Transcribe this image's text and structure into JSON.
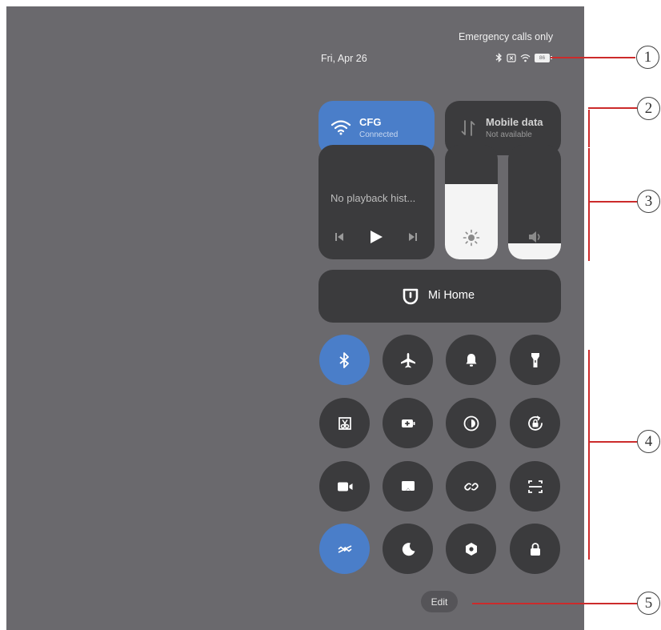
{
  "status_bar": {
    "carrier_text": "Emergency calls only",
    "date": "Fri, Apr 26",
    "battery_level": "86"
  },
  "tiles": {
    "wifi": {
      "title": "CFG",
      "status": "Connected",
      "active": true
    },
    "mobile_data": {
      "title": "Mobile data",
      "status": "Not available",
      "active": false
    }
  },
  "media": {
    "title": "No playback hist..."
  },
  "sliders": {
    "brightness": {
      "level": 0.66
    },
    "volume": {
      "level": 0.14
    }
  },
  "mi_home": {
    "label": "Mi Home"
  },
  "toggles": [
    {
      "icon": "bluetooth-icon",
      "active": true
    },
    {
      "icon": "airplane-icon",
      "active": false
    },
    {
      "icon": "bell-icon",
      "active": false
    },
    {
      "icon": "flashlight-icon",
      "active": false
    },
    {
      "icon": "screenshot-icon",
      "active": false
    },
    {
      "icon": "battery-saver-icon",
      "active": false
    },
    {
      "icon": "dark-mode-icon",
      "active": false
    },
    {
      "icon": "auto-rotate-lock-icon",
      "active": false
    },
    {
      "icon": "screen-recorder-icon",
      "active": false
    },
    {
      "icon": "cast-icon",
      "active": false
    },
    {
      "icon": "link-icon",
      "active": false
    },
    {
      "icon": "scanner-icon",
      "active": false
    },
    {
      "icon": "reading-mode-icon",
      "active": true
    },
    {
      "icon": "do-not-disturb-icon",
      "active": false
    },
    {
      "icon": "settings-nut-icon",
      "active": false
    },
    {
      "icon": "lock-screen-icon",
      "active": false
    }
  ],
  "edit_label": "Edit",
  "callouts": [
    "1",
    "2",
    "3",
    "4",
    "5"
  ],
  "colors": {
    "accent_blue": "#4a7ec9",
    "tile_dark": "#3b3b3d",
    "panel_bg": "#6a696d",
    "callout_red": "#cc2b2b"
  }
}
